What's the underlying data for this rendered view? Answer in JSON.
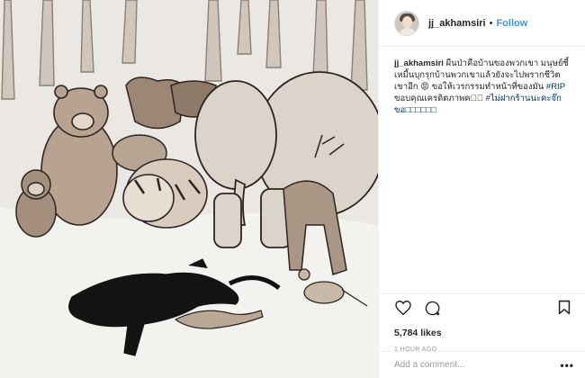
{
  "post": {
    "username": "jj_akhamsiri",
    "separator": "•",
    "follow_label": "Follow",
    "caption": {
      "user": "jj_akhamsiri",
      "text_1": " ผืนป่าคือบ้านของพวกเขา มนุษย์ชี้เหมี้นบุกรุกบ้านพวกเขาแล้วยังจะไปพรากชีวิตเขาอีก 😡 ขอให้เวรกรรมทำหน้าที่ของมัน ",
      "hashtag_1": "#RIP",
      "text_2": " ขอบคุณเครดิตภาพคะ🏻 ",
      "hashtag_2": "#ไม่ฝากร้านนะคะจ๊กขอ□□□□□□"
    },
    "likes": "5,784 likes",
    "time_ago": "1 HOUR AGO",
    "comment_placeholder": "Add a comment...",
    "more_label": "•••"
  },
  "icons": {
    "like": "heart-icon",
    "comment": "comment-icon",
    "save": "bookmark-icon",
    "options": "more-options-icon"
  },
  "colors": {
    "link": "#3897f0",
    "hashtag": "#003569",
    "muted": "#999999",
    "drawing_wash": "#8b7765"
  }
}
